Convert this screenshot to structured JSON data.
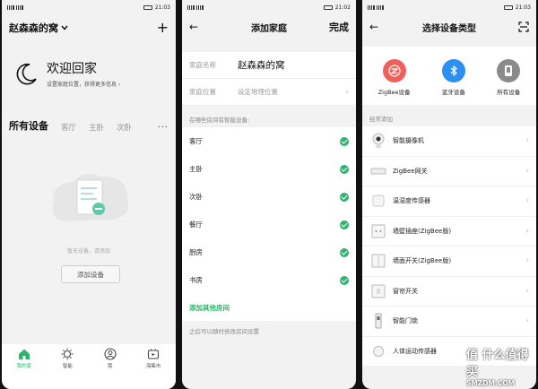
{
  "status_bars": [
    {
      "time": "21:03"
    },
    {
      "time": "21:02"
    },
    {
      "time": "21:03"
    }
  ],
  "home_screen": {
    "home_name": "赵森森的窝",
    "welcome_title": "欢迎回家",
    "welcome_sub": "设置家庭位置，获得更多信息 ›",
    "tabs": [
      "所有设备",
      "客厅",
      "主卧",
      "次卧"
    ],
    "more": "···",
    "empty_text": "暂无设备，请添加",
    "add_device": "添加设备",
    "nav": [
      {
        "label": "我的家",
        "icon": "home-icon"
      },
      {
        "label": "智能",
        "icon": "sun-icon"
      },
      {
        "label": "我",
        "icon": "user-icon"
      },
      {
        "label": "海集市",
        "icon": "market-icon"
      }
    ]
  },
  "add_home": {
    "title": "添加家庭",
    "done": "完成",
    "name_label": "家庭名称",
    "name_value": "赵森森的窝",
    "location_label": "家庭位置",
    "location_placeholder": "设定地理位置",
    "section_label": "在哪些房间有智能设备:",
    "rooms": [
      "客厅",
      "主卧",
      "次卧",
      "餐厅",
      "厨房",
      "书房"
    ],
    "add_other": "添加其他房间",
    "hint": "之后可以随时修改房间设置"
  },
  "device_type": {
    "title": "选择设备类型",
    "connections": [
      {
        "label": "ZigBee设备",
        "color": "#f0605a",
        "icon": "zigbee-icon"
      },
      {
        "label": "蓝牙设备",
        "color": "#2d8ff0",
        "icon": "bluetooth-icon"
      },
      {
        "label": "所有设备",
        "color": "#8a8a8a",
        "icon": "device-icon"
      }
    ],
    "frequent_label": "经常添加",
    "devices": [
      "智能摄像机",
      "ZigBee网关",
      "温湿度传感器",
      "墙壁插座(ZigBee版)",
      "墙面开关(ZigBee版)",
      "窗帘开关",
      "智能门锁",
      "人体运动传感器"
    ]
  },
  "watermark": {
    "top": "值 什么值得买",
    "bottom": "SMZDM.COM"
  }
}
